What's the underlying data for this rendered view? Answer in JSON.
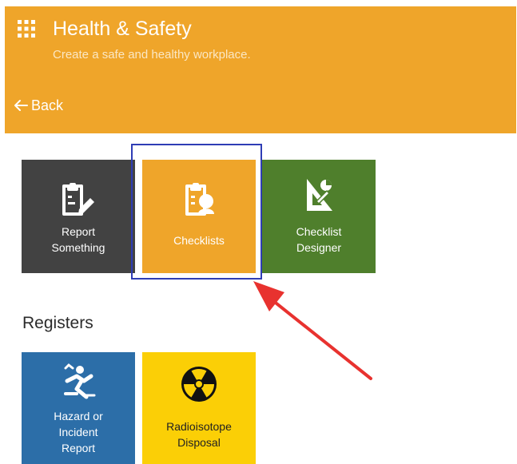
{
  "header": {
    "title": "Health & Safety",
    "subtitle": "Create a safe and healthy workplace.",
    "back_label": "Back",
    "menu_icon": "grid-menu-icon",
    "color": "#efa52a"
  },
  "tiles": [
    {
      "label": "Report\nSomething",
      "icon": "clipboard-pencil-icon",
      "color": "#424242"
    },
    {
      "label": "Checklists",
      "icon": "clipboard-user-icon",
      "color": "#efa52a"
    },
    {
      "label": "Checklist\nDesigner",
      "icon": "set-square-icon",
      "color": "#4f7f2c"
    }
  ],
  "registers": {
    "heading": "Registers",
    "tiles": [
      {
        "label": "Hazard or\nIncident\nReport",
        "icon": "falling-person-icon",
        "color": "#2c6ea8"
      },
      {
        "label": "Radioisotope\nDisposal",
        "icon": "radiation-icon",
        "color": "#fbcf06"
      }
    ]
  },
  "annotation": {
    "highlight_color": "#2f3db5",
    "arrow_color": "#e8322f"
  }
}
